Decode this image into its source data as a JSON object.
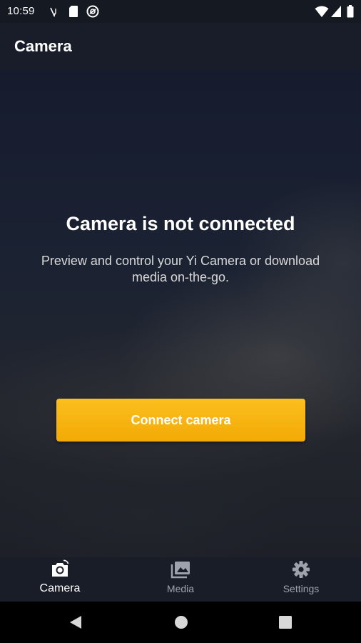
{
  "status_bar": {
    "time": "10:59",
    "left_icons": [
      "voicemail-icon",
      "sd-card-icon",
      "data-saver-icon"
    ],
    "right_icons": [
      "wifi-icon",
      "cell-signal-icon",
      "battery-icon"
    ]
  },
  "app_bar": {
    "title": "Camera"
  },
  "main": {
    "title": "Camera is not connected",
    "subtitle": "Preview and control your Yi Camera or download media on-the-go.",
    "connect_button_label": "Connect camera"
  },
  "bottom_nav": {
    "items": [
      {
        "label": "Camera",
        "icon": "camera-icon",
        "active": true
      },
      {
        "label": "Media",
        "icon": "media-gallery-icon",
        "active": false
      },
      {
        "label": "Settings",
        "icon": "gear-icon",
        "active": false
      }
    ]
  },
  "system_nav": {
    "buttons": [
      "back-icon",
      "home-icon",
      "recents-icon"
    ]
  },
  "colors": {
    "accent": "#f6b10e",
    "background": "#181d29",
    "active_text": "#ffffff",
    "inactive_text": "#9ea2aa"
  }
}
